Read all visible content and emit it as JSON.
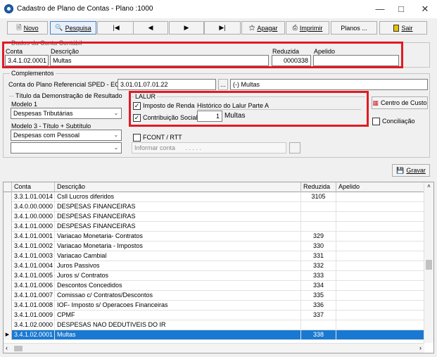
{
  "window": {
    "title": "Cadastro de Plano de Contas - Plano :1000"
  },
  "toolbar": {
    "novo": "Novo",
    "pesquisa": "Pesquisa",
    "first": "|◀",
    "prev": "◀",
    "next": "▶",
    "last": "▶|",
    "apagar": "Apagar",
    "imprimir": "Imprimir",
    "planos": "Planos ...",
    "sair": "Sair"
  },
  "dados": {
    "legend": "Dados da Conta Contábil",
    "conta_label": "Conta",
    "conta_value": "3.4.1.02.0001",
    "descricao_label": "Descrição",
    "descricao_value": "Multas",
    "reduzida_label": "Reduzida",
    "reduzida_value": "0000338",
    "apelido_label": "Apelido",
    "apelido_value": ""
  },
  "complementos": {
    "legend": "Complementos",
    "sped_label": "Conta do Plano Referencial SPED - ECF",
    "sped_value": "3.01.01.07.01.22",
    "sped_btn": "...",
    "sped_desc": "(-) Multas",
    "dre_legend": "Título da Demonstração de Resultado",
    "modelo1_label": "Modelo 1",
    "modelo1_value": "Despesas Tributárias",
    "modelo3_label": "Modelo 3 - Título + Subtítulo",
    "modelo3_value": "Despesas com Pessoal",
    "modelo3b_value": "",
    "lalur_legend": "LALUR",
    "imposto_renda": "Imposto de Renda",
    "contribuicao_social": "Contribuição Social",
    "historico_label": "Histórico do Lalur Parte A",
    "historico_num": "1",
    "historico_text": "Multas",
    "centro_custo": "Centro de Custo",
    "conciliacao": "Conciliação",
    "fcont": "FCONT / RTT",
    "informar_conta_placeholder": "Informar conta",
    "informar_conta_mask": ". . . . .",
    "gravar": "Gravar"
  },
  "grid": {
    "headers": {
      "conta": "Conta",
      "descricao": "Descrição",
      "reduzida": "Reduzida",
      "apelido": "Apelido"
    },
    "rows": [
      {
        "conta": "3.3.1.01.0014",
        "descricao": "Csll Lucros diferidos",
        "reduzida": "3105",
        "apelido": ""
      },
      {
        "conta": "3.4.0.00.0000",
        "descricao": "DESPESAS FINANCEIRAS",
        "reduzida": "",
        "apelido": ""
      },
      {
        "conta": "3.4.1.00.0000",
        "descricao": "DESPESAS FINANCEIRAS",
        "reduzida": "",
        "apelido": ""
      },
      {
        "conta": "3.4.1.01.0000",
        "descricao": "DESPESAS FINANCEIRAS",
        "reduzida": "",
        "apelido": ""
      },
      {
        "conta": "3.4.1.01.0001",
        "descricao": "Variacao Monetaria- Contratos",
        "reduzida": "329",
        "apelido": ""
      },
      {
        "conta": "3.4.1.01.0002",
        "descricao": "Variacao Monetaria - Impostos",
        "reduzida": "330",
        "apelido": ""
      },
      {
        "conta": "3.4.1.01.0003",
        "descricao": "Variacao Cambial",
        "reduzida": "331",
        "apelido": ""
      },
      {
        "conta": "3.4.1.01.0004",
        "descricao": "Juros Passivos",
        "reduzida": "332",
        "apelido": ""
      },
      {
        "conta": "3.4.1.01.0005",
        "descricao": "Juros s/ Contratos",
        "reduzida": "333",
        "apelido": ""
      },
      {
        "conta": "3.4.1.01.0006",
        "descricao": "Descontos Concedidos",
        "reduzida": "334",
        "apelido": ""
      },
      {
        "conta": "3.4.1.01.0007",
        "descricao": "Comissao c/ Contratos/Descontos",
        "reduzida": "335",
        "apelido": ""
      },
      {
        "conta": "3.4.1.01.0008",
        "descricao": "IOF- Imposto s/ Operacoes Financeiras",
        "reduzida": "336",
        "apelido": ""
      },
      {
        "conta": "3.4.1.01.0009",
        "descricao": "CPMF",
        "reduzida": "337",
        "apelido": ""
      },
      {
        "conta": "3.4.1.02.0000",
        "descricao": "DESPESAS NAO DEDUTIVEIS DO IR",
        "reduzida": "",
        "apelido": ""
      },
      {
        "conta": "3.4.1.02.0001",
        "descricao": "Multas",
        "reduzida": "338",
        "apelido": "",
        "selected": true
      }
    ]
  },
  "colors": {
    "accent_red": "#e01b24",
    "selection_blue": "#1979d2"
  }
}
